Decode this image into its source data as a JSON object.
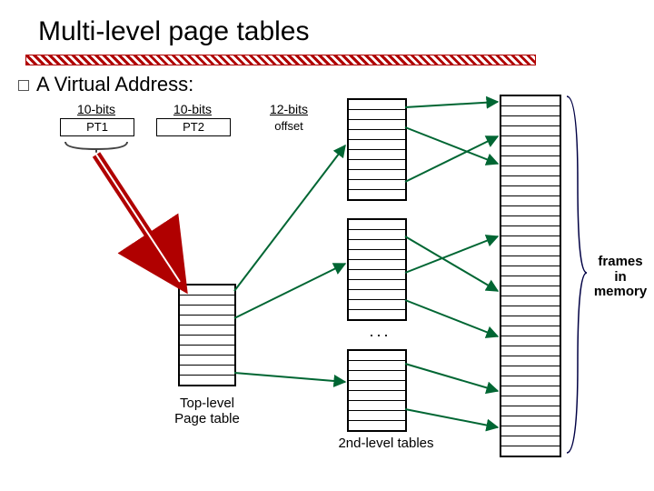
{
  "title": "Multi-level page tables",
  "subtitle": "A Virtual Address:",
  "fields": [
    {
      "bits": "10-bits",
      "label": "PT1"
    },
    {
      "bits": "10-bits",
      "label": "PT2"
    },
    {
      "bits": "12-bits",
      "label": "offset"
    }
  ],
  "captions": {
    "top_level": "Top-level\nPage table",
    "second_level": "2nd-level tables",
    "frames": "frames\nin\nmemory"
  }
}
